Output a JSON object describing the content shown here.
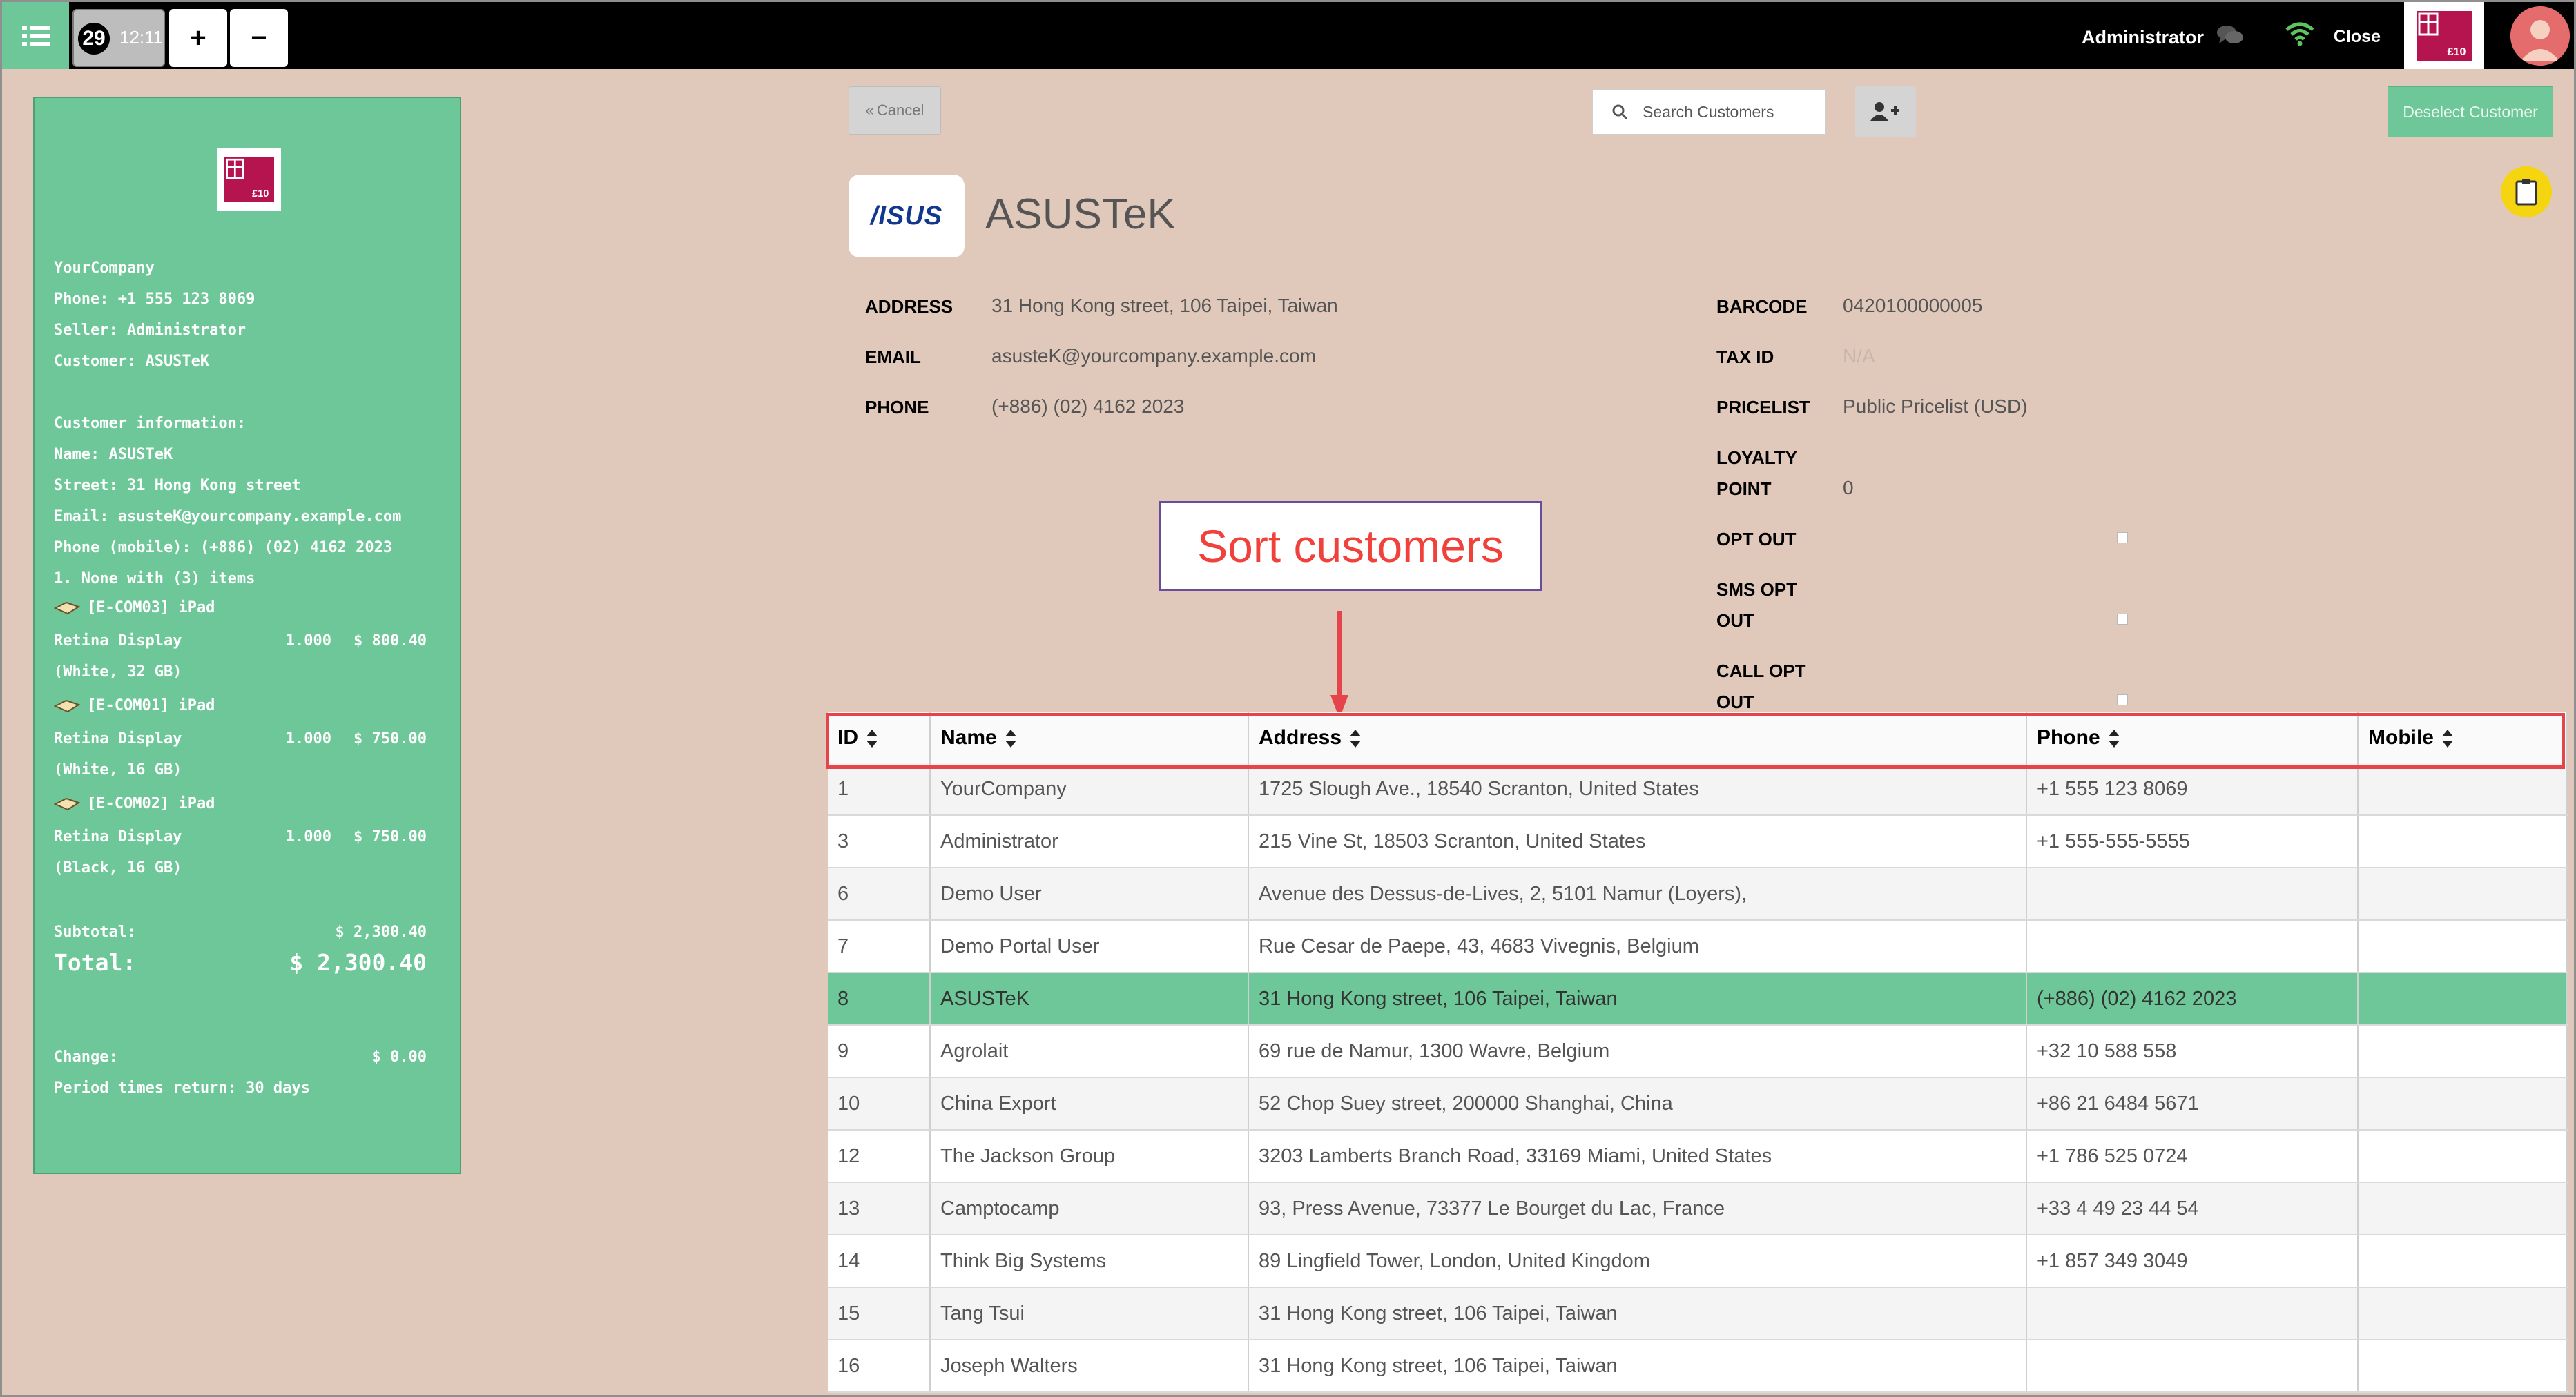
{
  "topbar": {
    "order_number": "29",
    "order_time": "12:11",
    "add_label": "+",
    "remove_label": "−",
    "user": "Administrator",
    "close_label": "Close",
    "gift_label": "£10"
  },
  "receipt": {
    "gift_label": "£10",
    "company": "YourCompany",
    "phone": "Phone: +1 555 123 8069",
    "seller": "Seller: Administrator",
    "customer": "Customer: ASUSTeK",
    "info_header": "Customer information:",
    "info_name": "Name: ASUSTeK",
    "info_street": "Street: 31 Hong Kong street",
    "info_email": "Email: asusteK@yourcompany.example.com",
    "info_phone": "Phone (mobile): (+886) (02) 4162 2023",
    "items_header": "1. None with (3) items",
    "items": [
      {
        "code": "[E-COM03] iPad",
        "line2": "Retina Display",
        "qty": "1.000",
        "price": "$ 800.40",
        "line3": "(White, 32 GB)"
      },
      {
        "code": "[E-COM01] iPad",
        "line2": "Retina Display",
        "qty": "1.000",
        "price": "$ 750.00",
        "line3": "(White, 16 GB)"
      },
      {
        "code": "[E-COM02] iPad",
        "line2": "Retina Display",
        "qty": "1.000",
        "price": "$ 750.00",
        "line3": "(Black, 16 GB)"
      }
    ],
    "subtotal_label": "Subtotal:",
    "subtotal_value": "$ 2,300.40",
    "total_label": "Total:",
    "total_value": "$ 2,300.40",
    "change_label": "Change:",
    "change_value": "$ 0.00",
    "period": "Period times return: 30 days"
  },
  "toolbar": {
    "cancel_label": "Cancel",
    "search_placeholder": "Search Customers",
    "deselect_label": "Deselect Customer"
  },
  "customer": {
    "name": "ASUSTeK",
    "logo_text": "/ISUS",
    "address_label": "ADDRESS",
    "address": "31 Hong Kong street, 106 Taipei, Taiwan",
    "email_label": "EMAIL",
    "email": "asusteK@yourcompany.example.com",
    "phone_label": "PHONE",
    "phone": "(+886) (02) 4162 2023",
    "barcode_label": "BARCODE",
    "barcode": "0420100000005",
    "taxid_label": "TAX ID",
    "taxid": "N/A",
    "pricelist_label": "PRICELIST",
    "pricelist": "Public Pricelist (USD)",
    "loyalty_label_1": "LOYALTY",
    "loyalty_label_2": "POINT",
    "loyalty": "0",
    "optout_label": "OPT OUT",
    "sms_label_1": "SMS OPT",
    "sms_label_2": "OUT",
    "call_label_1": "CALL OPT",
    "call_label_2": "OUT"
  },
  "annotation": {
    "text": "Sort customers"
  },
  "table": {
    "headers": [
      "ID",
      "Name",
      "Address",
      "Phone",
      "Mobile"
    ],
    "rows": [
      {
        "id": "1",
        "name": "YourCompany",
        "address": "1725 Slough Ave., 18540 Scranton, United States",
        "phone": "+1 555 123 8069",
        "mobile": ""
      },
      {
        "id": "3",
        "name": "Administrator",
        "address": "215 Vine St, 18503 Scranton, United States",
        "phone": "+1 555-555-5555",
        "mobile": ""
      },
      {
        "id": "6",
        "name": "Demo User",
        "address": "Avenue des Dessus-de-Lives, 2, 5101 Namur (Loyers),",
        "phone": "",
        "mobile": ""
      },
      {
        "id": "7",
        "name": "Demo Portal User",
        "address": "Rue Cesar de Paepe, 43, 4683 Vivegnis, Belgium",
        "phone": "",
        "mobile": ""
      },
      {
        "id": "8",
        "name": "ASUSTeK",
        "address": "31 Hong Kong street, 106 Taipei, Taiwan",
        "phone": "(+886) (02) 4162 2023",
        "mobile": ""
      },
      {
        "id": "9",
        "name": "Agrolait",
        "address": "69 rue de Namur, 1300 Wavre, Belgium",
        "phone": "+32 10 588 558",
        "mobile": ""
      },
      {
        "id": "10",
        "name": "China Export",
        "address": "52 Chop Suey street, 200000 Shanghai, China",
        "phone": "+86 21 6484 5671",
        "mobile": ""
      },
      {
        "id": "12",
        "name": "The Jackson Group",
        "address": "3203 Lamberts Branch Road, 33169 Miami, United States",
        "phone": "+1 786 525 0724",
        "mobile": ""
      },
      {
        "id": "13",
        "name": "Camptocamp",
        "address": "93, Press Avenue, 73377 Le Bourget du Lac, France",
        "phone": "+33 4 49 23 44 54",
        "mobile": ""
      },
      {
        "id": "14",
        "name": "Think Big Systems",
        "address": "89 Lingfield Tower, London, United Kingdom",
        "phone": "+1 857 349 3049",
        "mobile": ""
      },
      {
        "id": "15",
        "name": "Tang Tsui",
        "address": "31 Hong Kong street, 106 Taipei, Taiwan",
        "phone": "",
        "mobile": ""
      },
      {
        "id": "16",
        "name": "Joseph Walters",
        "address": "31 Hong Kong street, 106 Taipei, Taiwan",
        "phone": "",
        "mobile": ""
      }
    ]
  },
  "colors": {
    "accent_green": "#6ec798",
    "background": "#e0c9bb",
    "annotation_red": "#f0413b",
    "annotation_border": "#6a4c9c",
    "header_outline": "#e5444b"
  }
}
